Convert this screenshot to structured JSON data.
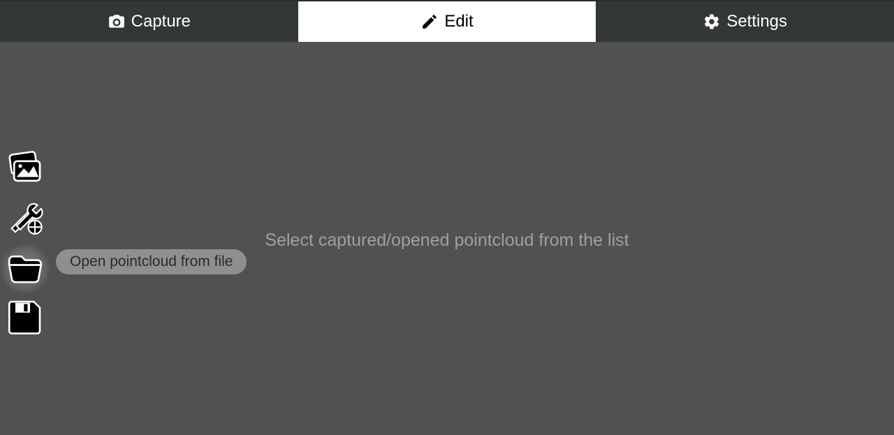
{
  "tabs": {
    "capture": "Capture",
    "edit": "Edit",
    "settings": "Settings",
    "active": "edit"
  },
  "main": {
    "placeholder_message": "Select captured/opened pointcloud from the list"
  },
  "toolbar": {
    "items": [
      {
        "name": "images-icon",
        "tooltip": ""
      },
      {
        "name": "tools-icon",
        "tooltip": ""
      },
      {
        "name": "open-file-icon",
        "tooltip": "Open pointcloud from file",
        "selected": true
      },
      {
        "name": "save-icon",
        "tooltip": ""
      }
    ]
  },
  "tooltip": {
    "open_file": "Open pointcloud from file"
  }
}
